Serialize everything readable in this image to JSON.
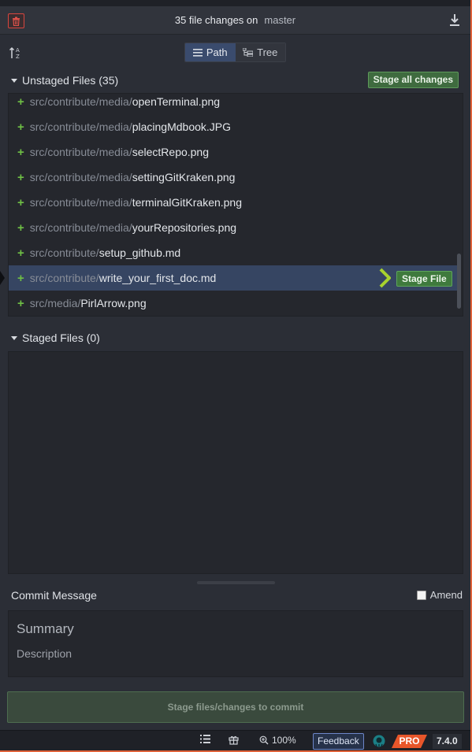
{
  "header": {
    "title": "35 file changes on",
    "branch": "master"
  },
  "toolbar": {
    "path_label": "Path",
    "tree_label": "Tree",
    "active_view": "Path"
  },
  "unstaged": {
    "title": "Unstaged Files (35)",
    "stage_all_label": "Stage all changes",
    "stage_file_label": "Stage File",
    "files": [
      {
        "dir": "src/contribute/media/",
        "name": "openTerminal.png"
      },
      {
        "dir": "src/contribute/media/",
        "name": "placingMdbook.JPG"
      },
      {
        "dir": "src/contribute/media/",
        "name": "selectRepo.png"
      },
      {
        "dir": "src/contribute/media/",
        "name": "settingGitKraken.png"
      },
      {
        "dir": "src/contribute/media/",
        "name": "terminalGitKraken.png"
      },
      {
        "dir": "src/contribute/media/",
        "name": "yourRepositories.png"
      },
      {
        "dir": "src/contribute/",
        "name": "setup_github.md"
      },
      {
        "dir": "src/contribute/",
        "name": "write_your_first_doc.md"
      },
      {
        "dir": "src/media/",
        "name": "PirlArrow.png"
      }
    ]
  },
  "staged": {
    "title": "Staged Files (0)"
  },
  "commit": {
    "title": "Commit Message",
    "amend_label": "Amend",
    "summary_placeholder": "Summary",
    "description_placeholder": "Description",
    "commit_button_label": "Stage files/changes to commit"
  },
  "statusbar": {
    "zoom": "100%",
    "feedback_label": "Feedback",
    "pro_label": "PRO",
    "version": "7.4.0"
  },
  "colors": {
    "accent_green": "#5ea55b",
    "selected_row": "#364562",
    "pro_orange": "#e8562a"
  }
}
